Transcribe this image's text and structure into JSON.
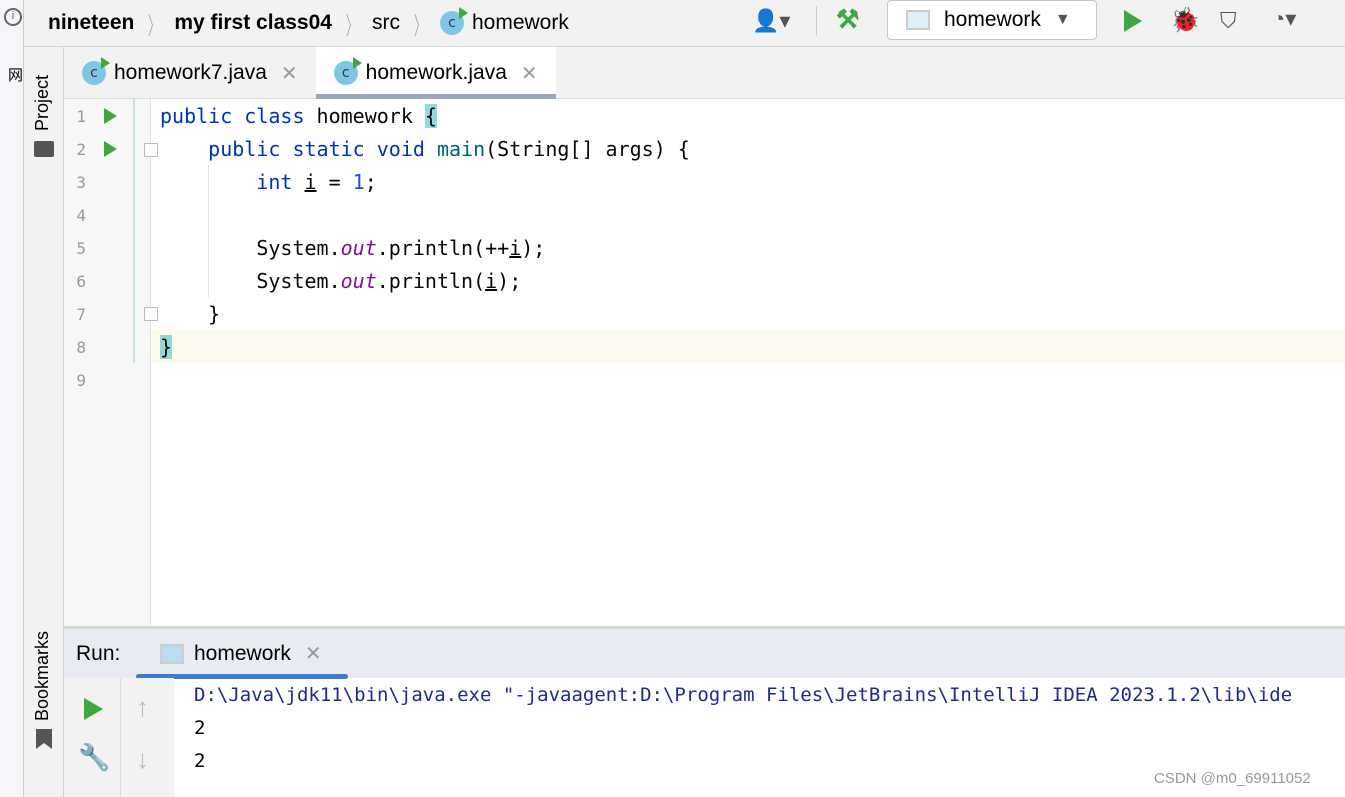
{
  "breadcrumb": [
    "nineteen",
    "my first class04",
    "src",
    "homework"
  ],
  "toolbar": {
    "run_config": "homework"
  },
  "sidebar": {
    "project": "Project",
    "bookmarks": "Bookmarks",
    "left_char": "网"
  },
  "tabs": [
    {
      "label": "homework7.java",
      "active": false
    },
    {
      "label": "homework.java",
      "active": true
    }
  ],
  "line_numbers": [
    "1",
    "2",
    "3",
    "4",
    "5",
    "6",
    "7",
    "8",
    "9"
  ],
  "run": {
    "label": "Run:",
    "tab": "homework",
    "output": [
      "D:\\Java\\jdk11\\bin\\java.exe \"-javaagent:D:\\Program Files\\JetBrains\\IntelliJ IDEA 2023.1.2\\lib\\ide",
      "2",
      "2"
    ]
  },
  "watermark": "CSDN @m0_69911052"
}
